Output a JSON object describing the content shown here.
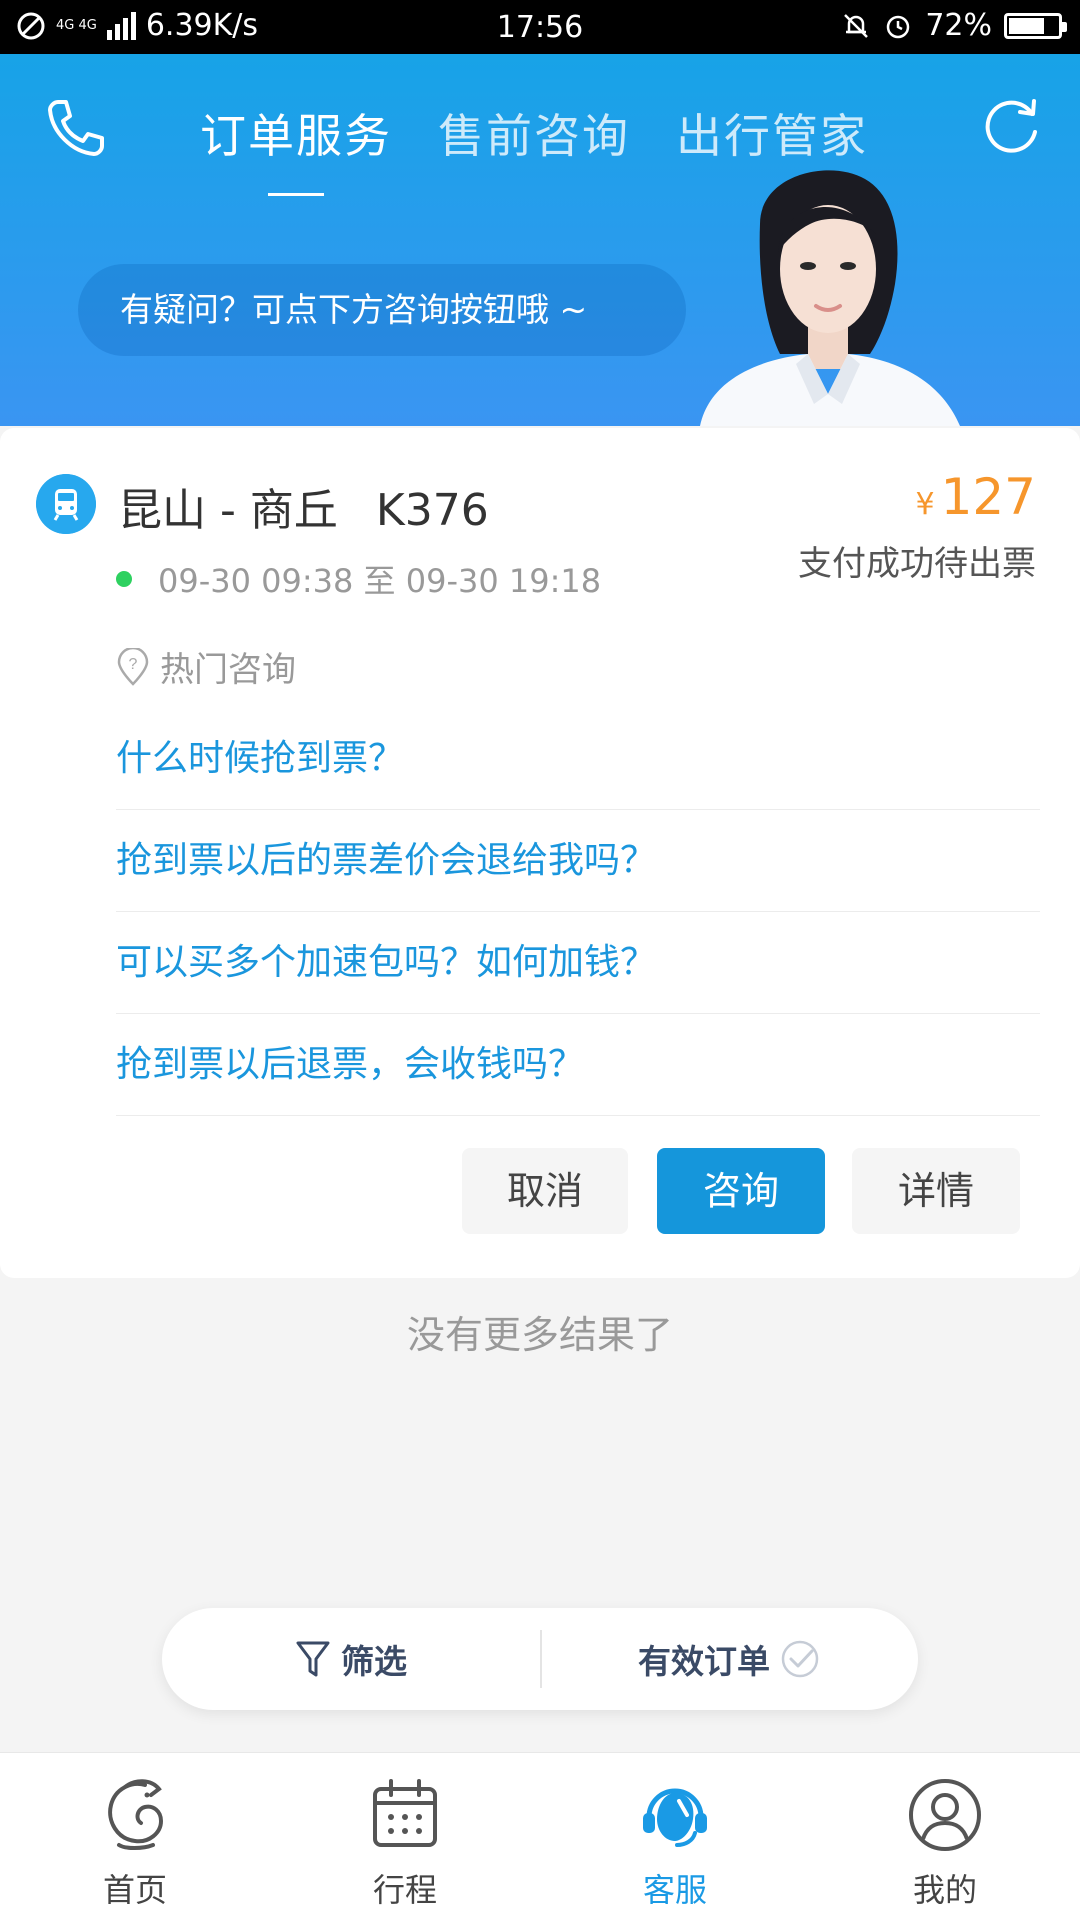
{
  "status_bar": {
    "network": "4G 4G",
    "speed": "6.39K/s",
    "time": "17:56",
    "battery": "72%",
    "battery_level": 0.72
  },
  "header": {
    "tabs": [
      "订单服务",
      "售前咨询",
      "出行管家"
    ],
    "active_tab": 0,
    "bubble_text": "有疑问？可点下方咨询按钮哦 ~",
    "icons": {
      "left": "phone-icon",
      "right": "refresh-icon"
    }
  },
  "order": {
    "route": "昆山 - 商丘",
    "train": "K376",
    "currency": "¥",
    "price": "127",
    "status": "支付成功待出票",
    "time_range": "09-30 09:38 至 09-30 19:18",
    "hot_label": "热门咨询",
    "faq": [
      "什么时候抢到票？",
      "抢到票以后的票差价会退给我吗？",
      "可以买多个加速包吗？如何加钱？",
      "抢到票以后退票，会收钱吗？"
    ],
    "buttons": {
      "cancel": "取消",
      "consult": "咨询",
      "detail": "详情"
    }
  },
  "no_more": "没有更多结果了",
  "filter_bar": {
    "filter": "筛选",
    "valid_orders": "有效订单"
  },
  "bottom_nav": {
    "items": [
      {
        "label": "首页",
        "icon": "home-icon"
      },
      {
        "label": "行程",
        "icon": "calendar-icon"
      },
      {
        "label": "客服",
        "icon": "customer-service-icon"
      },
      {
        "label": "我的",
        "icon": "profile-icon"
      }
    ],
    "active_index": 2
  },
  "colors": {
    "accent": "#1596db",
    "price": "#f6962c",
    "link": "#1a96dd",
    "header_top": "#17a3e7",
    "header_bottom": "#3a95f2"
  }
}
